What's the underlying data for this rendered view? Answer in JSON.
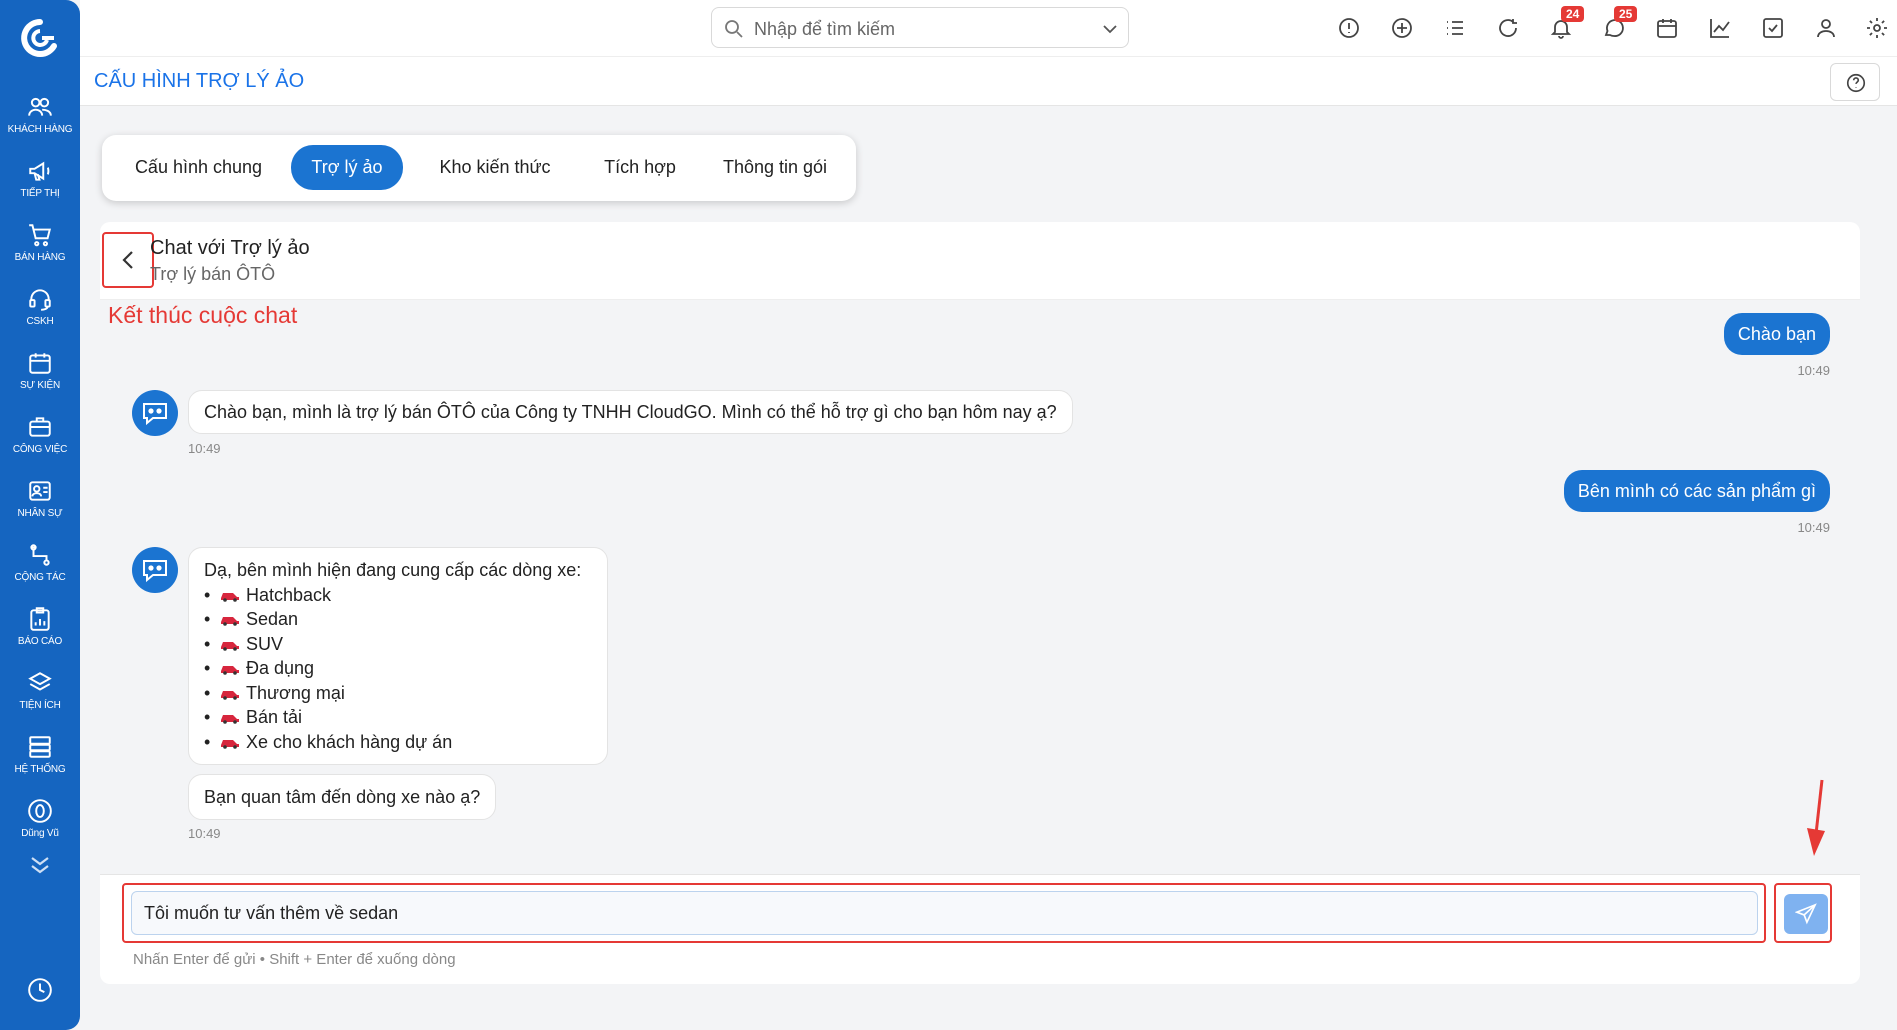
{
  "sidebar": {
    "items": [
      {
        "label": "KHÁCH HÀNG",
        "icon": "users-icon"
      },
      {
        "label": "TIẾP THỊ",
        "icon": "megaphone-icon"
      },
      {
        "label": "BÁN HÀNG",
        "icon": "cart-icon"
      },
      {
        "label": "CSKH",
        "icon": "headset-icon"
      },
      {
        "label": "SỰ KIỆN",
        "icon": "calendar-icon"
      },
      {
        "label": "CÔNG VIỆC",
        "icon": "briefcase-icon"
      },
      {
        "label": "NHÂN SỰ",
        "icon": "id-card-icon"
      },
      {
        "label": "CỘNG TÁC",
        "icon": "network-icon"
      },
      {
        "label": "BÁO CÁO",
        "icon": "report-icon"
      },
      {
        "label": "TIỆN ÍCH",
        "icon": "layers-icon"
      },
      {
        "label": "HỆ THỐNG",
        "icon": "server-icon"
      },
      {
        "label": "Dũng Vũ",
        "icon": "user-counter-icon"
      }
    ]
  },
  "header": {
    "search_placeholder": "Nhập để tìm kiếm",
    "notifications_count": "24",
    "messages_count": "25"
  },
  "page": {
    "title": "CẤU HÌNH TRỢ LÝ ẢO"
  },
  "tabs": [
    {
      "label": "Cấu hình chung",
      "active": false
    },
    {
      "label": "Trợ lý ảo",
      "active": true
    },
    {
      "label": "Kho kiến thức",
      "active": false
    },
    {
      "label": "Tích hợp",
      "active": false
    },
    {
      "label": "Thông tin gói",
      "active": false
    }
  ],
  "chat": {
    "title": "Chat với Trợ lý ảo",
    "subtitle": "Trợ lý bán ÔTÔ",
    "annotation": "Kết thúc cuộc chat",
    "messages": [
      {
        "from": "user",
        "text": "Chào bạn",
        "time": "10:49"
      },
      {
        "from": "bot",
        "text": "Chào bạn, mình là trợ lý bán ÔTÔ của Công ty TNHH CloudGO. Mình có thể hỗ trợ gì cho bạn hôm nay ạ?",
        "time": "10:49"
      },
      {
        "from": "user",
        "text": "Bên mình có các sản phẩm gì",
        "time": "10:49"
      },
      {
        "from": "bot",
        "intro": "Dạ, bên mình hiện đang cung cấp các dòng xe:",
        "items": [
          "Hatchback",
          "Sedan",
          "SUV",
          "Đa dụng",
          "Thương mại",
          "Bán tải",
          "Xe cho khách hàng dự án"
        ],
        "followup": "Bạn quan tâm đến dòng xe nào ạ?",
        "time": "10:49"
      }
    ],
    "input_value": "Tôi muốn tư vấn thêm về sedan",
    "hint": "Nhấn Enter để gửi • Shift + Enter để xuống dòng"
  },
  "colors": {
    "primary": "#1b74d1",
    "sidebar": "#1565c0",
    "annotation": "#e53935",
    "badge": "#e53935"
  }
}
